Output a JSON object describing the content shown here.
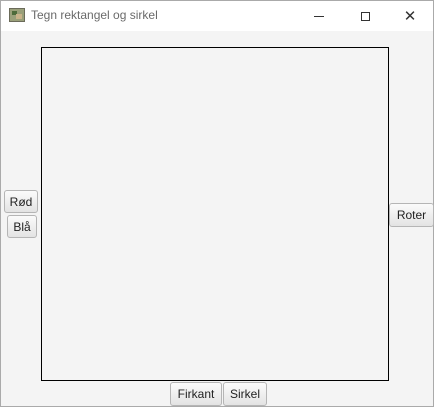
{
  "window": {
    "title": "Tegn rektangel og sirkel",
    "icon": "app-image-icon",
    "controls": {
      "minimize": "minimize-icon",
      "maximize": "maximize-icon",
      "close": "close-icon",
      "close_glyph": "✕"
    }
  },
  "color_buttons": [
    {
      "label": "Rød"
    },
    {
      "label": "Blå"
    }
  ],
  "rotate_button": {
    "label": "Roter"
  },
  "shape_buttons": [
    {
      "label": "Firkant"
    },
    {
      "label": "Sirkel"
    }
  ]
}
